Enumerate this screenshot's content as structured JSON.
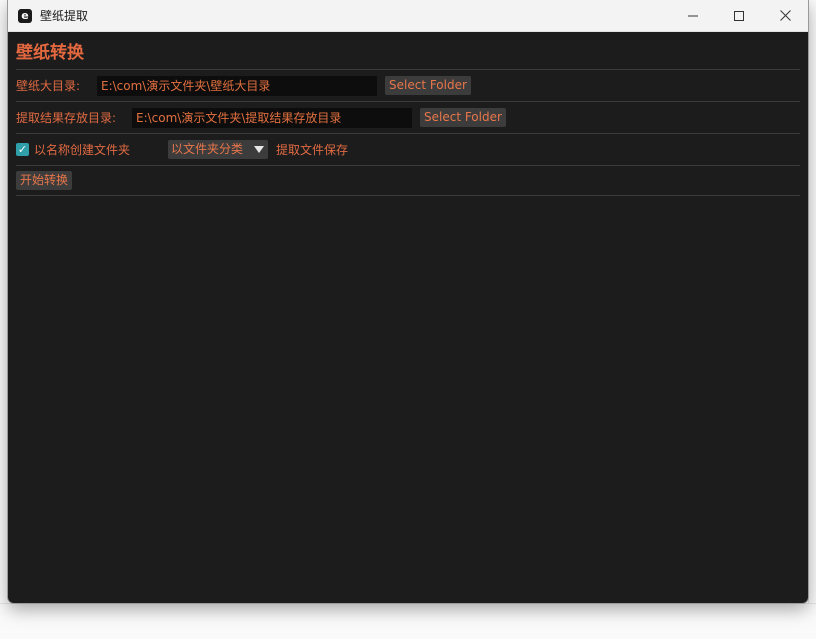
{
  "window": {
    "app_icon_glyph": "e",
    "title": "壁纸提取",
    "controls": {
      "minimize": "minimize-icon",
      "maximize": "maximize-icon",
      "close": "close-icon"
    }
  },
  "main": {
    "heading": "壁纸转换",
    "source": {
      "label": "壁纸大目录:",
      "value": "E:\\com\\演示文件夹\\壁纸大目录",
      "button": "Select Folder"
    },
    "output": {
      "label": "提取结果存放目录:",
      "value": "E:\\com\\演示文件夹\\提取结果存放目录",
      "button": "Select Folder"
    },
    "options": {
      "checkbox_label": "以名称创建文件夹",
      "checkbox_checked": true,
      "combo_value": "以文件夹分类",
      "save_label": "提取文件保存"
    },
    "start_button": "开始转换"
  },
  "colors": {
    "accent": "#e4683f",
    "window_bg": "#1c1c1c",
    "input_bg": "#0d0d0d",
    "button_bg": "#3c3c3c",
    "checkbox": "#2f9fa9",
    "separator": "#3b3b3b"
  }
}
